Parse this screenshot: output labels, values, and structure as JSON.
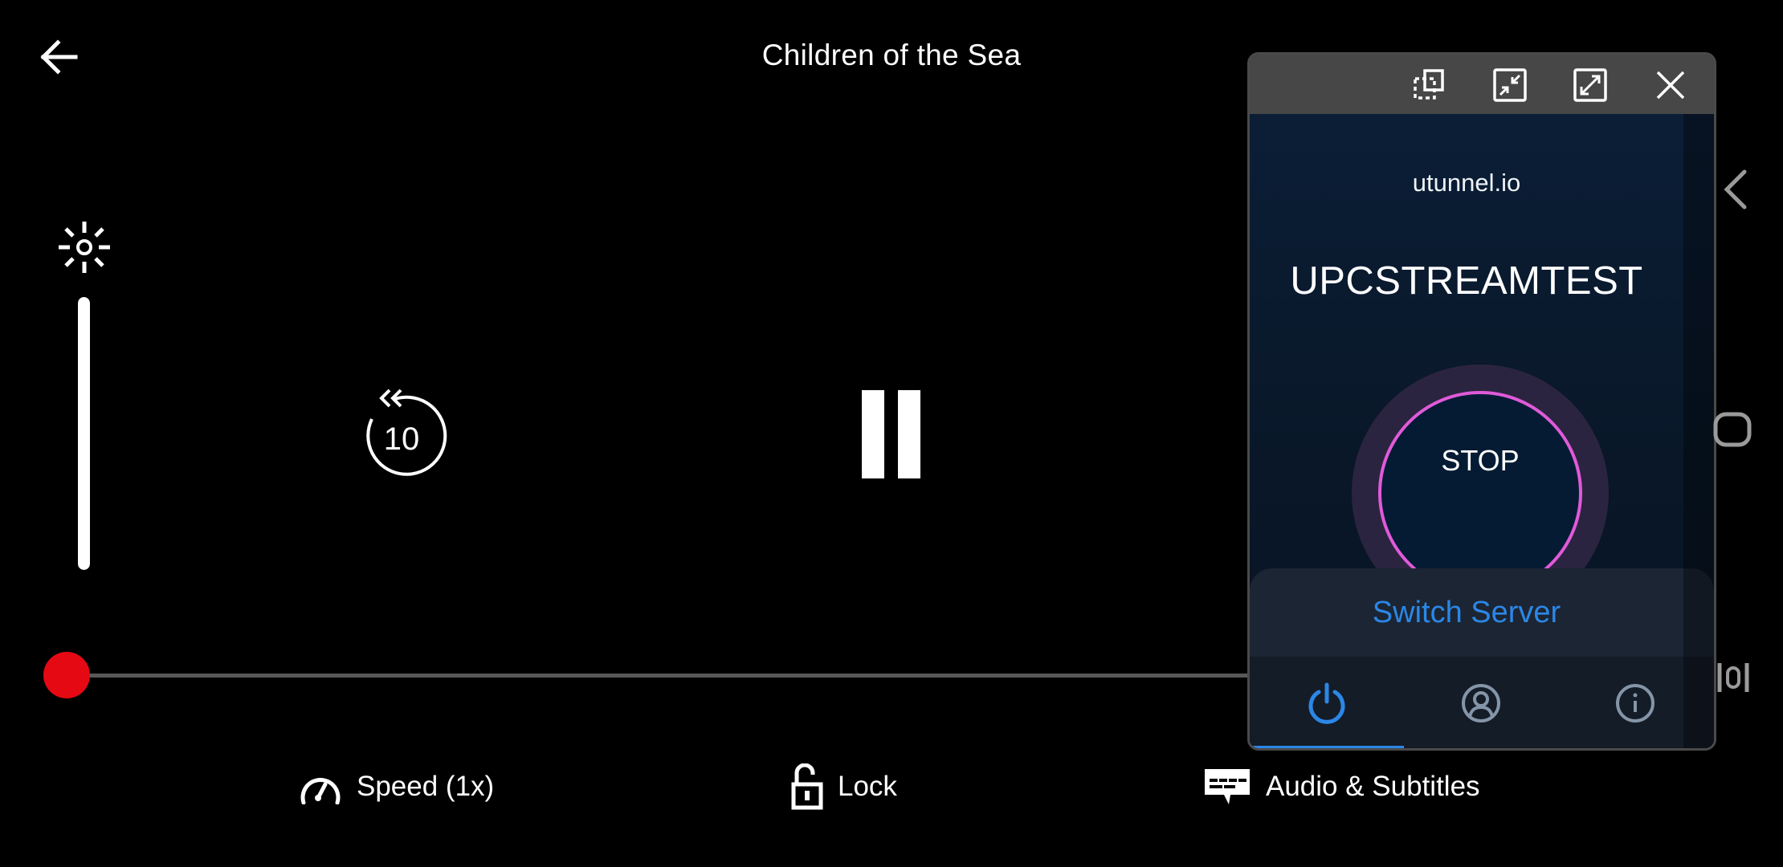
{
  "player": {
    "title": "Children of the Sea",
    "back_icon": "arrow-left-icon",
    "brightness": {
      "icon": "sun-icon",
      "level": 1.0
    },
    "rewind": {
      "icon": "rewind-10-icon",
      "seconds_label": "10"
    },
    "playback_state": "playing",
    "pause_icon": "pause-icon",
    "progress": {
      "fraction": 0.0,
      "accent": "#e50914",
      "track": "#585858"
    },
    "toolbar": [
      {
        "id": "speed",
        "icon": "speedometer-icon",
        "label": "Speed (1x)"
      },
      {
        "id": "lock",
        "icon": "unlock-icon",
        "label": "Lock"
      },
      {
        "id": "audio",
        "icon": "subtitles-icon",
        "label": "Audio & Subtitles"
      }
    ]
  },
  "floating_window": {
    "controls": [
      {
        "id": "pop-out",
        "icon": "pop-out-window-icon"
      },
      {
        "id": "minimize",
        "icon": "minimize-icon"
      },
      {
        "id": "maximize",
        "icon": "maximize-icon"
      },
      {
        "id": "close",
        "icon": "close-icon"
      }
    ],
    "vpn": {
      "brand": "utunnel.io",
      "server_name": "UPCSTREAMTEST",
      "connect_button_label": "STOP",
      "ring_color": "#e05ad9",
      "accent": "#2b87e6",
      "switch_server_label": "Switch Server",
      "tabs": [
        {
          "id": "connect",
          "icon": "power-icon",
          "active": true
        },
        {
          "id": "account",
          "icon": "user-circle-icon",
          "active": false
        },
        {
          "id": "info",
          "icon": "info-icon",
          "active": false
        }
      ]
    }
  },
  "system_nav": {
    "back": "nav-back-icon",
    "home": "nav-home-icon",
    "recents": "nav-recents-icon"
  }
}
